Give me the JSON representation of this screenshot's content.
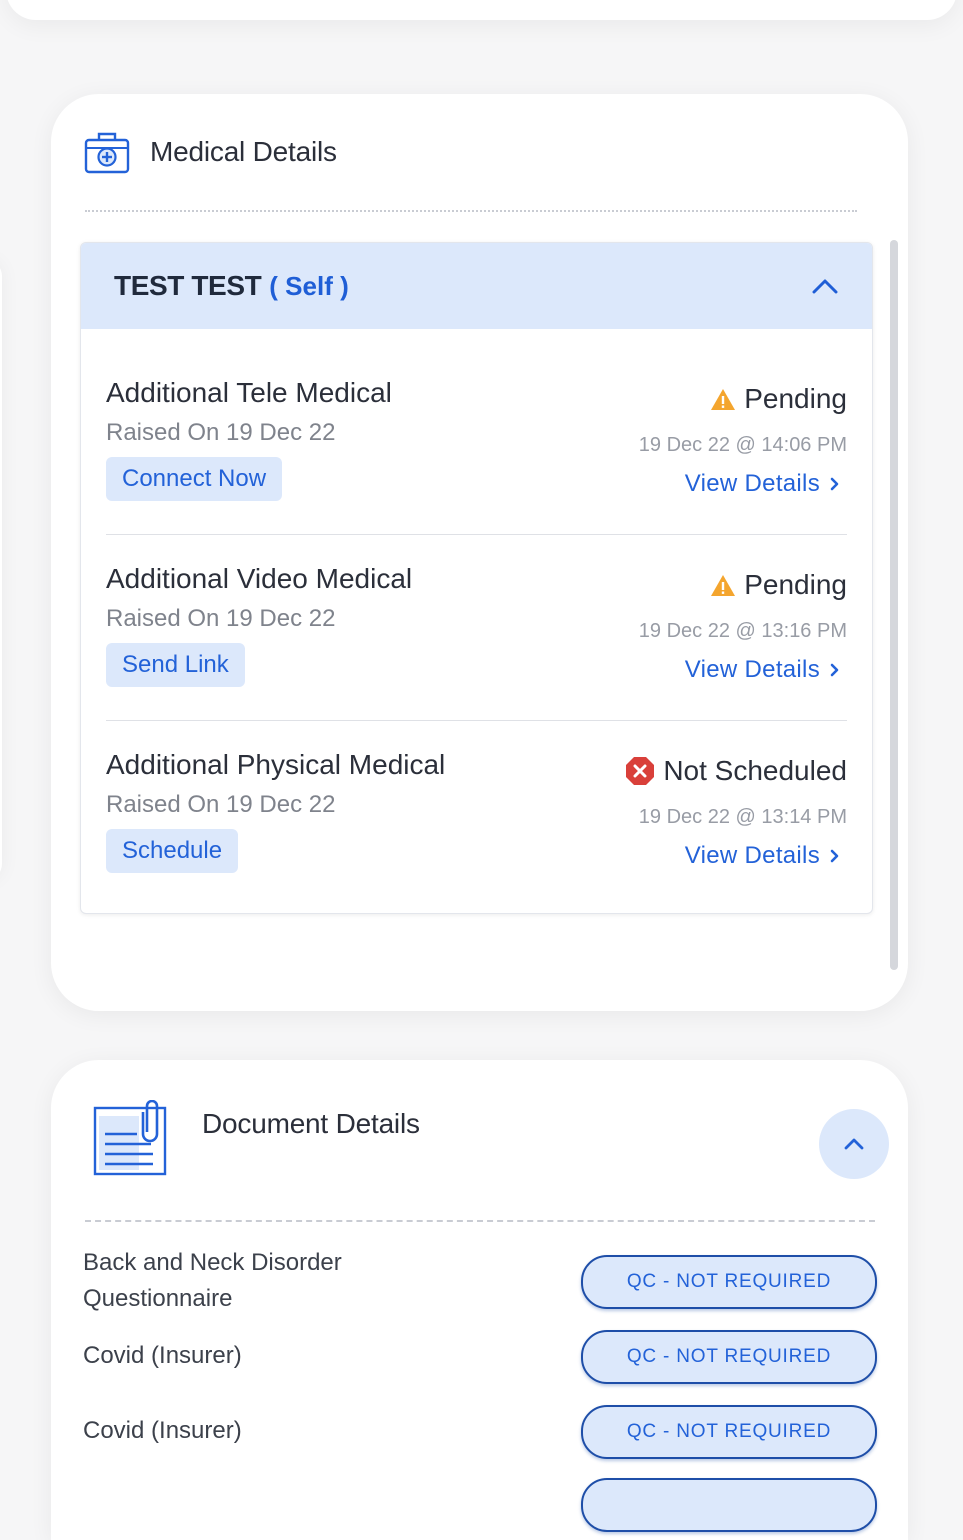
{
  "medical": {
    "title": "Medical Details",
    "icon": "medical-kit-icon",
    "applicant": {
      "name": "TEST TEST",
      "relation": "( Self )",
      "expanded": true
    },
    "items": [
      {
        "title": "Additional Tele Medical",
        "raised": "Raised On 19 Dec 22",
        "action": "Connect Now",
        "status": "Pending",
        "status_icon": "warning-icon",
        "time": "19 Dec 22 @ 14:06 PM",
        "view": "View Details"
      },
      {
        "title": "Additional Video Medical",
        "raised": "Raised On 19 Dec 22",
        "action": "Send Link",
        "status": "Pending",
        "status_icon": "warning-icon",
        "time": "19 Dec 22 @ 13:16 PM",
        "view": "View Details"
      },
      {
        "title": "Additional Physical Medical",
        "raised": "Raised On 19 Dec 22",
        "action": "Schedule",
        "status": "Not Scheduled",
        "status_icon": "error-icon",
        "time": "19 Dec 22 @ 13:14 PM",
        "view": "View Details"
      }
    ]
  },
  "documents": {
    "title": "Document Details",
    "icon": "document-clip-icon",
    "rows": [
      {
        "label_line1": "Back and Neck Disorder",
        "label_line2": "Questionnaire",
        "status": "QC - NOT REQUIRED"
      },
      {
        "label_line1": "Covid (Insurer)",
        "label_line2": "",
        "status": "QC - NOT REQUIRED"
      },
      {
        "label_line1": "Covid (Insurer)",
        "label_line2": "",
        "status": "QC - NOT REQUIRED"
      }
    ]
  },
  "colors": {
    "accent": "#2362d8",
    "accent_bg": "#dce8fb",
    "pending": "#f4a52e",
    "error": "#d9403a"
  }
}
